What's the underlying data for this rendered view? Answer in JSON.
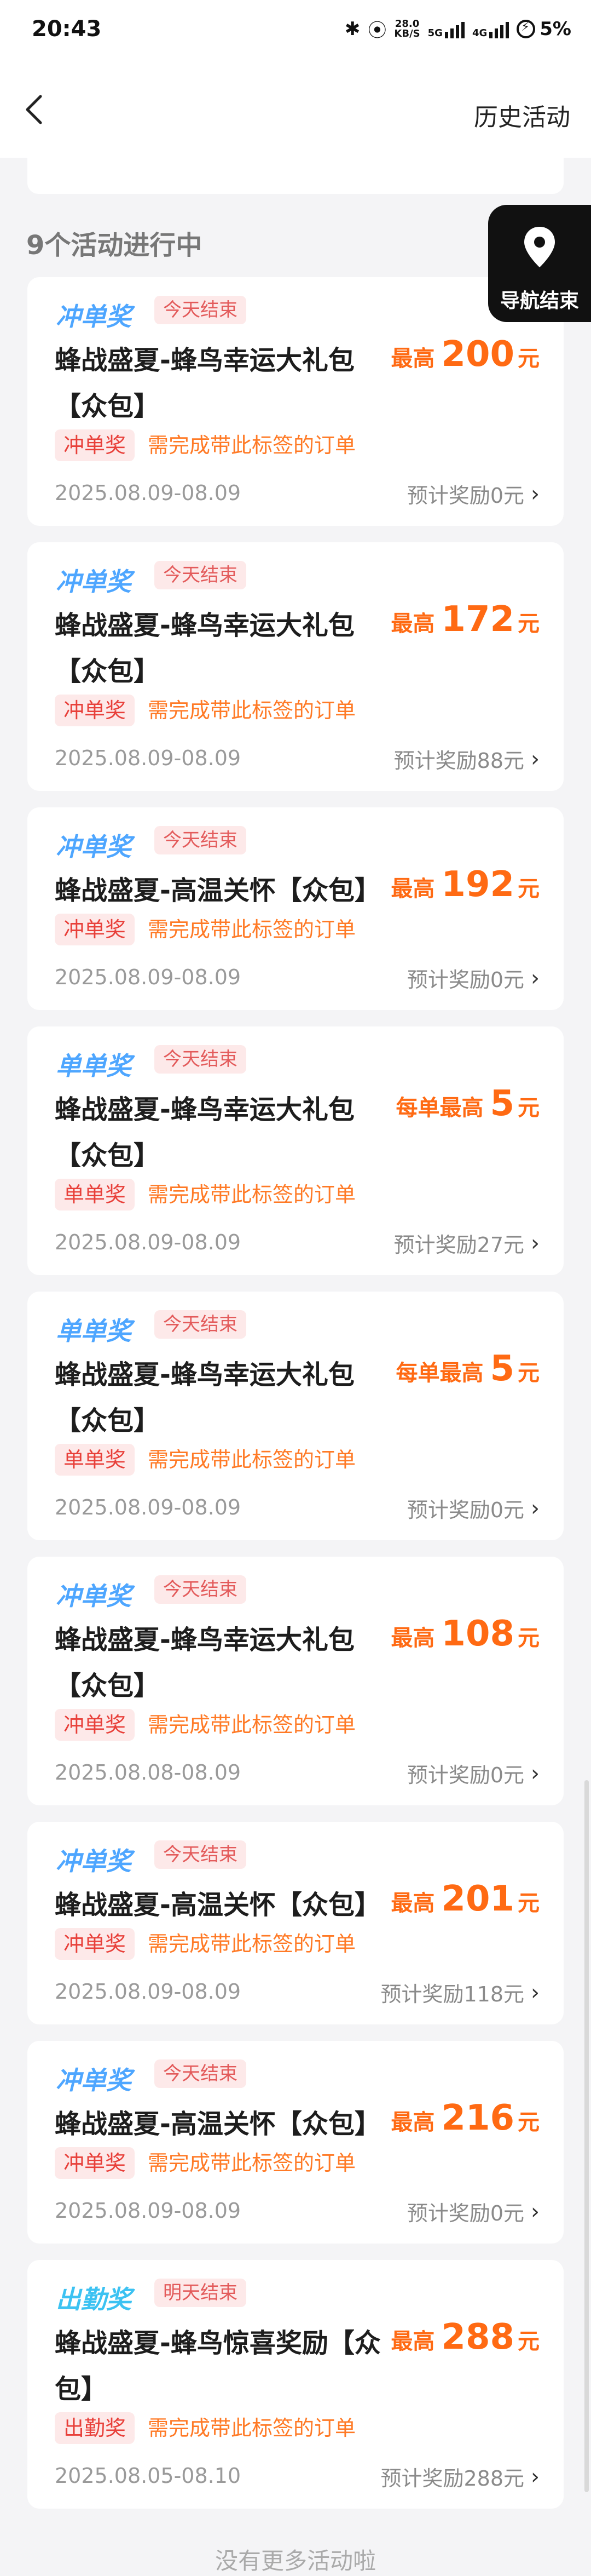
{
  "status_bar": {
    "time": "20:43",
    "net_speed_value": "28.0",
    "net_speed_unit": "KB/S",
    "net1": "5G",
    "net2": "4G",
    "battery": "5%"
  },
  "nav": {
    "history_label": "历史活动"
  },
  "section_title": "9个活动进行中",
  "nav_button_label": "导航结束",
  "footer_text": "没有更多活动啦",
  "cards": [
    {
      "type": "冲单奖",
      "badge": "今天结束",
      "title": "蜂战盛夏-蜂鸟幸运大礼包【众包】",
      "reward_prefix": "最高",
      "reward_amount": "200",
      "reward_unit": "元",
      "tag": "冲单奖",
      "requirement": "需完成带此标签的订单",
      "date": "2025.08.09-08.09",
      "estimate": "预计奖励0元"
    },
    {
      "type": "冲单奖",
      "badge": "今天结束",
      "title": "蜂战盛夏-蜂鸟幸运大礼包【众包】",
      "reward_prefix": "最高",
      "reward_amount": "172",
      "reward_unit": "元",
      "tag": "冲单奖",
      "requirement": "需完成带此标签的订单",
      "date": "2025.08.09-08.09",
      "estimate": "预计奖励88元"
    },
    {
      "type": "冲单奖",
      "badge": "今天结束",
      "title": "蜂战盛夏-高温关怀【众包】",
      "reward_prefix": "最高",
      "reward_amount": "192",
      "reward_unit": "元",
      "tag": "冲单奖",
      "requirement": "需完成带此标签的订单",
      "date": "2025.08.09-08.09",
      "estimate": "预计奖励0元"
    },
    {
      "type": "单单奖",
      "badge": "今天结束",
      "title": "蜂战盛夏-蜂鸟幸运大礼包【众包】",
      "reward_prefix": "每单最高",
      "reward_amount": "5",
      "reward_unit": "元",
      "tag": "单单奖",
      "requirement": "需完成带此标签的订单",
      "date": "2025.08.09-08.09",
      "estimate": "预计奖励27元"
    },
    {
      "type": "单单奖",
      "badge": "今天结束",
      "title": "蜂战盛夏-蜂鸟幸运大礼包【众包】",
      "reward_prefix": "每单最高",
      "reward_amount": "5",
      "reward_unit": "元",
      "tag": "单单奖",
      "requirement": "需完成带此标签的订单",
      "date": "2025.08.09-08.09",
      "estimate": "预计奖励0元"
    },
    {
      "type": "冲单奖",
      "badge": "今天结束",
      "title": "蜂战盛夏-蜂鸟幸运大礼包【众包】",
      "reward_prefix": "最高",
      "reward_amount": "108",
      "reward_unit": "元",
      "tag": "冲单奖",
      "requirement": "需完成带此标签的订单",
      "date": "2025.08.08-08.09",
      "estimate": "预计奖励0元"
    },
    {
      "type": "冲单奖",
      "badge": "今天结束",
      "title": "蜂战盛夏-高温关怀【众包】",
      "reward_prefix": "最高",
      "reward_amount": "201",
      "reward_unit": "元",
      "tag": "冲单奖",
      "requirement": "需完成带此标签的订单",
      "date": "2025.08.09-08.09",
      "estimate": "预计奖励118元"
    },
    {
      "type": "冲单奖",
      "badge": "今天结束",
      "title": "蜂战盛夏-高温关怀【众包】",
      "reward_prefix": "最高",
      "reward_amount": "216",
      "reward_unit": "元",
      "tag": "冲单奖",
      "requirement": "需完成带此标签的订单",
      "date": "2025.08.09-08.09",
      "estimate": "预计奖励0元"
    },
    {
      "type": "出勤奖",
      "badge": "明天结束",
      "title": "蜂战盛夏-蜂鸟惊喜奖励【众包】",
      "reward_prefix": "最高",
      "reward_amount": "288",
      "reward_unit": "元",
      "tag": "出勤奖",
      "requirement": "需完成带此标签的订单",
      "date": "2025.08.05-08.10",
      "estimate": "预计奖励288元"
    }
  ]
}
